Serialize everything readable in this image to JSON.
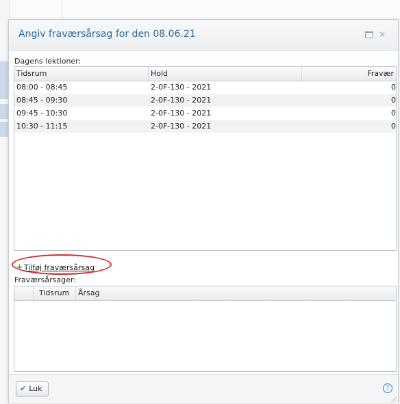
{
  "dialog": {
    "title": "Angiv fraværsårsag for den 08.06.21",
    "maximize_icon": "maximize-icon",
    "close_icon": "close-icon",
    "close_glyph": "×"
  },
  "lessons": {
    "section_label": "Dagens lektioner:",
    "columns": [
      "Tidsrum",
      "Hold",
      "Fravær"
    ],
    "rows": [
      {
        "time": "08:00 - 08:45",
        "hold": "2-0F-130 - 2021",
        "absence": "0"
      },
      {
        "time": "08:45 - 09:30",
        "hold": "2-0F-130 - 2021",
        "absence": "0"
      },
      {
        "time": "09:45 - 10:30",
        "hold": "2-0F-130 - 2021",
        "absence": "0"
      },
      {
        "time": "10:30 - 11:15",
        "hold": "2-0F-130 - 2021",
        "absence": "0"
      }
    ]
  },
  "add_reason": {
    "plus_glyph": "+",
    "label": "Tilføj fraværsårsag"
  },
  "reasons": {
    "section_label": "Fraværsårsager:",
    "columns": [
      "Tidsrum",
      "Årsag"
    ]
  },
  "footer": {
    "close_label": "Luk",
    "check_glyph": "✔",
    "help_glyph": "?"
  },
  "colors": {
    "title": "#2a6a9e",
    "highlight_ellipse": "#d7282f",
    "plus_icon": "#4aa832"
  }
}
